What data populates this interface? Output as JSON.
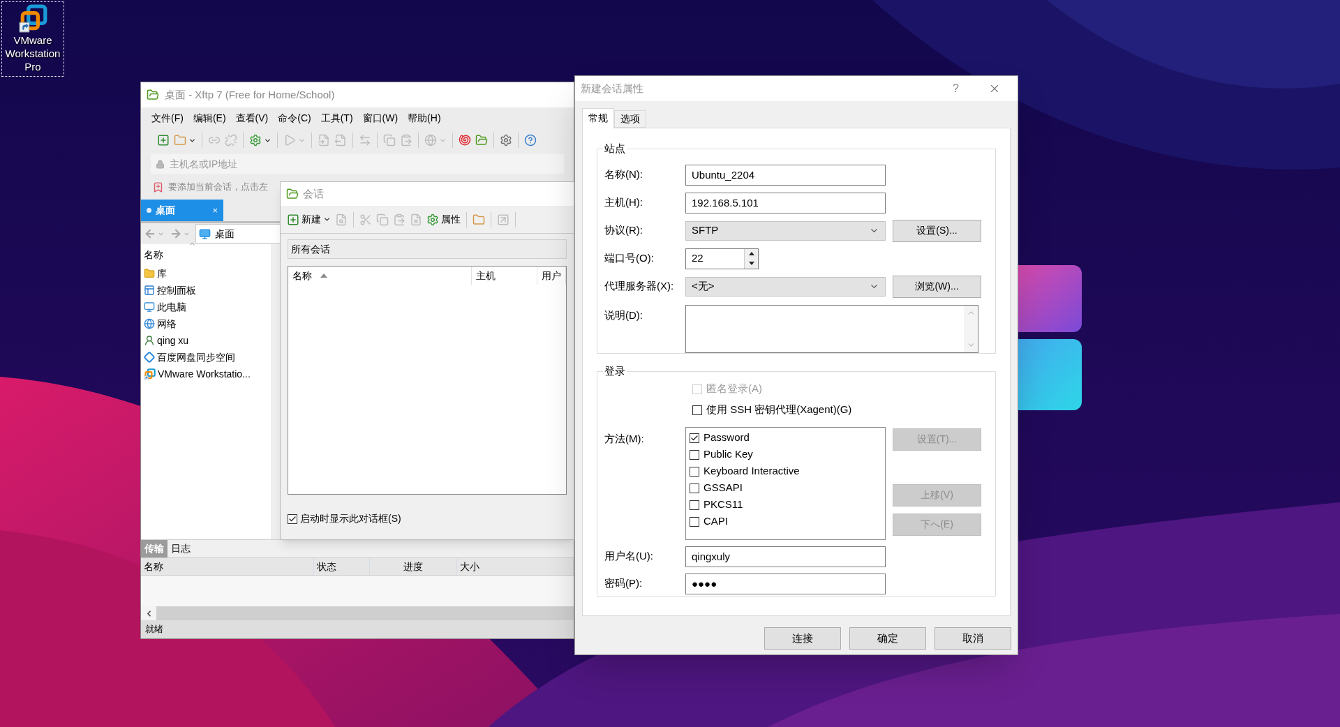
{
  "desktop_icons": [
    {
      "label": "VMware Workstation Pro",
      "selected": true
    }
  ],
  "xftp": {
    "title": "桌面 - Xftp 7 (Free for Home/School)",
    "menu": [
      "文件(F)",
      "编辑(E)",
      "查看(V)",
      "命令(C)",
      "工具(T)",
      "窗口(W)",
      "帮助(H)"
    ],
    "toolbar": [
      {
        "kind": "new-session",
        "disabled": false
      },
      {
        "kind": "open",
        "disabled": false,
        "dropdown": true
      },
      {
        "kind": "separator"
      },
      {
        "kind": "connect",
        "disabled": true
      },
      {
        "kind": "disconnect",
        "disabled": true
      },
      {
        "kind": "separator"
      },
      {
        "kind": "properties",
        "disabled": false,
        "dropdown": true
      },
      {
        "kind": "separator"
      },
      {
        "kind": "play",
        "disabled": true,
        "dropdown": true
      },
      {
        "kind": "separator"
      },
      {
        "kind": "download",
        "disabled": true
      },
      {
        "kind": "upload",
        "disabled": true
      },
      {
        "kind": "separator"
      },
      {
        "kind": "sync",
        "disabled": true
      },
      {
        "kind": "separator"
      },
      {
        "kind": "copy",
        "disabled": true
      },
      {
        "kind": "paste",
        "disabled": true
      },
      {
        "kind": "separator"
      },
      {
        "kind": "globe",
        "disabled": true,
        "dropdown": true
      },
      {
        "kind": "separator"
      },
      {
        "kind": "swirl",
        "disabled": false
      },
      {
        "kind": "xftp",
        "disabled": false
      },
      {
        "kind": "separator"
      },
      {
        "kind": "settings",
        "disabled": false
      },
      {
        "kind": "separator"
      },
      {
        "kind": "help",
        "disabled": false
      }
    ],
    "address": {
      "placeholder": "主机名或IP地址"
    },
    "hint": "要添加当前会话，点击左",
    "tabs": [
      {
        "label": "桌面",
        "selected": true,
        "close": "×"
      }
    ],
    "path": "桌面",
    "file_list": {
      "column": "名称",
      "items": [
        {
          "name": "库",
          "kind": "library"
        },
        {
          "name": "控制面板",
          "kind": "control-panel"
        },
        {
          "name": "此电脑",
          "kind": "computer"
        },
        {
          "name": "网络",
          "kind": "network"
        },
        {
          "name": "qing xu",
          "kind": "user"
        },
        {
          "name": "百度网盘同步空间",
          "kind": "sync"
        },
        {
          "name": "VMware Workstatio...",
          "kind": "shortcut"
        }
      ]
    },
    "bottom_tabs": [
      {
        "label": "传输",
        "selected": true
      },
      {
        "label": "日志",
        "selected": false
      }
    ],
    "transfer_columns": [
      "名称",
      "状态",
      "进度",
      "大小"
    ],
    "status": "就绪"
  },
  "sessions": {
    "title": "会话",
    "toolbar": [
      {
        "kind": "new-session",
        "label": "新建",
        "disabled": false,
        "dropdown": true
      },
      {
        "kind": "search",
        "disabled": true
      },
      {
        "kind": "separator"
      },
      {
        "kind": "cut",
        "disabled": true
      },
      {
        "kind": "copy",
        "disabled": true
      },
      {
        "kind": "paste",
        "disabled": true
      },
      {
        "kind": "delete",
        "disabled": true
      },
      {
        "kind": "properties",
        "label": "属性",
        "disabled": false
      },
      {
        "kind": "separator"
      },
      {
        "kind": "open",
        "disabled": false
      },
      {
        "kind": "separator"
      },
      {
        "kind": "export",
        "disabled": true
      },
      {
        "kind": "separator"
      }
    ],
    "folder": "所有会话",
    "columns": [
      "名称",
      "主机",
      "用户"
    ],
    "show_on_startup": {
      "label": "启动时显示此对话框(S)",
      "checked": true
    }
  },
  "new_session": {
    "title": "新建会话属性",
    "help": "?",
    "tabs": [
      {
        "label": "常规",
        "selected": true
      },
      {
        "label": "选项",
        "selected": false
      }
    ],
    "site": {
      "legend": "站点",
      "fields": [
        {
          "kind": "text",
          "label": "名称(N):",
          "value": "Ubuntu_2204"
        },
        {
          "kind": "text",
          "label": "主机(H):",
          "value": "192.168.5.101"
        },
        {
          "kind": "select",
          "label": "协议(R):",
          "value": "SFTP",
          "button": "设置(S)..."
        },
        {
          "kind": "spin",
          "label": "端口号(O):",
          "value": "22"
        },
        {
          "kind": "select",
          "label": "代理服务器(X):",
          "value": "<无>",
          "button": "浏览(W)..."
        },
        {
          "kind": "textarea",
          "label": "说明(D):"
        }
      ]
    },
    "login": {
      "legend": "登录",
      "options": [
        {
          "label": "匿名登录(A)",
          "checked": false,
          "disabled": true
        },
        {
          "label": "使用 SSH 密钥代理(Xagent)(G)",
          "checked": false,
          "disabled": false
        }
      ],
      "method_label": "方法(M):",
      "methods": [
        {
          "label": "Password",
          "checked": true
        },
        {
          "label": "Public Key",
          "checked": false
        },
        {
          "label": "Keyboard Interactive",
          "checked": false
        },
        {
          "label": "GSSAPI",
          "checked": false
        },
        {
          "label": "PKCS11",
          "checked": false
        },
        {
          "label": "CAPI",
          "checked": false
        }
      ],
      "method_buttons": [
        {
          "label": "设置(T)...",
          "disabled": true
        },
        {
          "label": "上移(V)",
          "disabled": true
        },
        {
          "label": "下へ(E)",
          "disabled": true
        }
      ],
      "username": {
        "label": "用户名(U):",
        "value": "qingxuly"
      },
      "password": {
        "label": "密码(P):",
        "value": "●●●●"
      }
    },
    "buttons": [
      "连接",
      "确定",
      "取消"
    ]
  }
}
